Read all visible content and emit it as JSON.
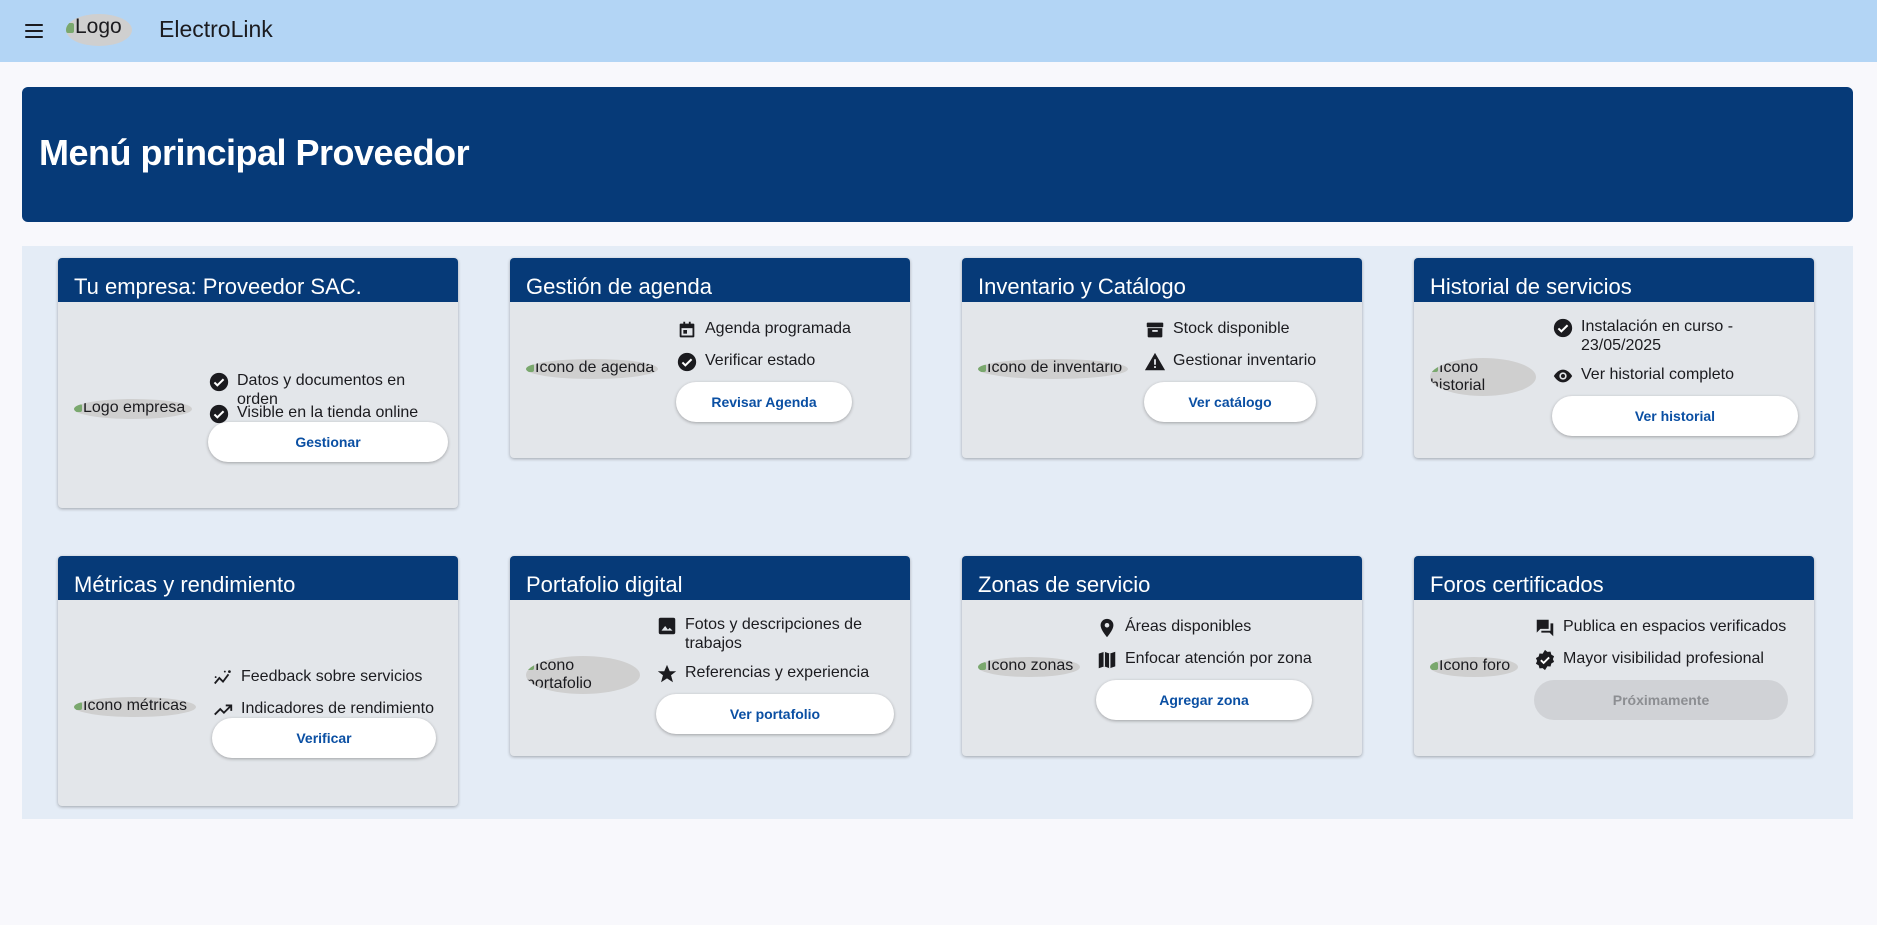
{
  "app": {
    "logo_alt": "Logo",
    "title": "ElectroLink"
  },
  "hero": {
    "title": "Menú principal Proveedor"
  },
  "colors": {
    "topbar": "#b3d5f5",
    "primary": "#063a78",
    "button_text": "#0a4fa3",
    "card_bg": "#e3e6ea"
  },
  "cards": [
    {
      "title": "Tu empresa: Proveedor SAC.",
      "img_alt": "Logo empresa",
      "features": [
        {
          "icon": "check-circle-icon",
          "text": "Datos y documentos en orden"
        },
        {
          "icon": "check-circle-icon",
          "text": "Visible en la tienda online"
        }
      ],
      "button": "Gestionar"
    },
    {
      "title": "Gestión de agenda",
      "img_alt": "Icono de agenda",
      "features": [
        {
          "icon": "calendar-icon",
          "text": "Agenda programada"
        },
        {
          "icon": "check-circle-icon",
          "text": "Verificar estado"
        }
      ],
      "button": "Revisar Agenda"
    },
    {
      "title": "Inventario y Catálogo",
      "img_alt": "Icono de inventario",
      "features": [
        {
          "icon": "archive-box-icon",
          "text": "Stock disponible"
        },
        {
          "icon": "warning-icon",
          "text": "Gestionar inventario"
        }
      ],
      "button": "Ver catálogo"
    },
    {
      "title": "Historial de servicios",
      "img_alt": "Icono historial",
      "features": [
        {
          "icon": "check-circle-icon",
          "text": "Instalación en curso - 23/05/2025"
        },
        {
          "icon": "eye-icon",
          "text": "Ver historial completo"
        }
      ],
      "button": "Ver historial"
    },
    {
      "title": "Métricas y rendimiento",
      "img_alt": "Icono métricas",
      "features": [
        {
          "icon": "insights-icon",
          "text": "Feedback sobre servicios"
        },
        {
          "icon": "trending-up-icon",
          "text": "Indicadores de rendimiento"
        }
      ],
      "button": "Verificar"
    },
    {
      "title": "Portafolio digital",
      "img_alt": "Icono portafolio",
      "features": [
        {
          "icon": "image-icon",
          "text": "Fotos y descripciones de trabajos"
        },
        {
          "icon": "star-icon",
          "text": "Referencias y experiencia"
        }
      ],
      "button": "Ver portafolio"
    },
    {
      "title": "Zonas de servicio",
      "img_alt": "Icono zonas",
      "features": [
        {
          "icon": "location-pin-icon",
          "text": "Áreas disponibles"
        },
        {
          "icon": "map-icon",
          "text": "Enfocar atención por zona"
        }
      ],
      "button": "Agregar zona"
    },
    {
      "title": "Foros certificados",
      "img_alt": "Icono foro",
      "features": [
        {
          "icon": "forum-icon",
          "text": "Publica en espacios verificados"
        },
        {
          "icon": "verified-badge-icon",
          "text": "Mayor visibilidad profesional"
        }
      ],
      "button": "Próximamente",
      "button_disabled": true
    }
  ]
}
